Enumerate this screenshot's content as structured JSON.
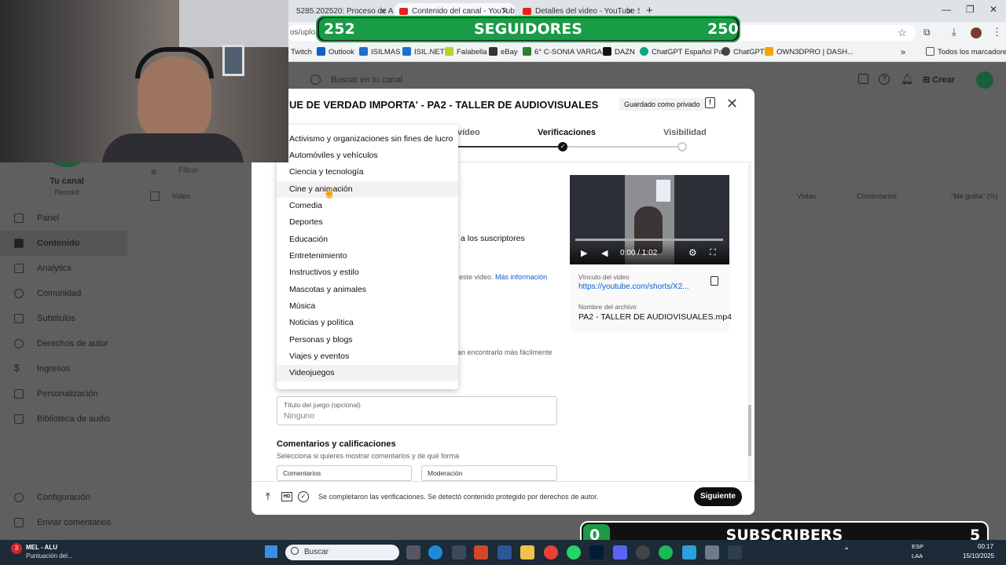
{
  "browser": {
    "tabs": [
      {
        "label": "5285.202520: Proceso de Apre",
        "active": false
      },
      {
        "label": "Contenido del canal - YouTub",
        "active": true
      },
      {
        "label": "Detalles del video - YouTube S",
        "active": false
      }
    ],
    "url": "os/uploa",
    "bookmarks": [
      "Twitch",
      "Outlook",
      "ISILMAS",
      "ISIL.NET",
      "Falabella",
      "eBay",
      "6° C-SONIA VARGA...",
      "DAZN",
      "ChatGPT Español Pa...",
      "ChatGPT",
      "OWN3DPRO | DASH...",
      "Todos los marcadores"
    ]
  },
  "header": {
    "search_placeholder": "Buscar en tu canal",
    "create_label": "Crear"
  },
  "sidebar": {
    "channel_title": "Tu canal",
    "channel_name": "Renzed",
    "items": [
      "Panel",
      "Contenido",
      "Analytics",
      "Comunidad",
      "Subtítulos",
      "Derechos de autor",
      "Ingresos",
      "Personalización",
      "Biblioteca de audio"
    ],
    "selected": "Contenido",
    "bottom_items": [
      "Configuración",
      "Enviar comentarios"
    ]
  },
  "content_table": {
    "filter_label": "Filtrar",
    "columns": [
      "Video",
      "Vistas",
      "Comentarios",
      "\"Me gusta\" (%)"
    ]
  },
  "modal": {
    "title": "UE DE VERDAD IMPORTA' - PA2 - TALLER DE AUDIOVISUALES",
    "saved_badge": "Guardado como privado",
    "steps": [
      "vídeo",
      "Verificaciones",
      "Visibilidad"
    ],
    "partial_texts": {
      "subscribers": "a los suscriptores",
      "este_video": "este video.",
      "mas_info": "Más información",
      "encontrarlo": "an encontrarlo más fácilmente"
    },
    "video": {
      "time": "0:00 / 1:02",
      "link_label": "Vínculo del video",
      "link": "https://youtube.com/shorts/X2...",
      "file_label": "Nombre del archivo",
      "file_name": "PA2 - TALLER DE AUDIOVISUALES.mp4"
    },
    "game_field": {
      "label": "Título del juego (opcional)",
      "value": "Ninguno"
    },
    "comments_section": {
      "title": "Comentarios y calificaciones",
      "subtitle": "Selecciona si quieres mostrar comentarios y de qué forma",
      "field1": "Comentarios",
      "field2": "Moderación"
    },
    "footer": {
      "status": "Se completaron las verificaciones. Se detectó contenido protegido por derechos de autor.",
      "hd_label": "HD",
      "next_button": "Siguiente"
    }
  },
  "dropdown": {
    "options": [
      "Activismo y organizaciones sin fines de lucro",
      "Automóviles y vehículos",
      "Ciencia y tecnología",
      "Cine y animación",
      "Comedia",
      "Deportes",
      "Educación",
      "Entretenimiento",
      "Instructivos y estilo",
      "Mascotas y animales",
      "Música",
      "Noticias y política",
      "Personas y blogs",
      "Viajes y eventos",
      "Videojuegos"
    ],
    "hovered": "Cine y animación",
    "selected": "Videojuegos"
  },
  "overlays": {
    "top_banner": {
      "left_number": "252",
      "label": "SEGUIDORES",
      "right_number": "250"
    },
    "bottom_banner": {
      "left_number": "0",
      "label": "SUBSCRIBERS",
      "right_number": "5"
    }
  },
  "taskbar": {
    "notification_count": "3",
    "app_title": "MEL - ALU",
    "app_subtitle": "Puntuación del...",
    "search_placeholder": "Buscar",
    "lang_top": "ESP",
    "lang_bottom": "LAA",
    "time": "00:17",
    "date": "15/10/2025"
  },
  "colors": {
    "accent_green": "#1a9b45",
    "youtube_red": "#e62117",
    "link_blue": "#065fd4"
  }
}
